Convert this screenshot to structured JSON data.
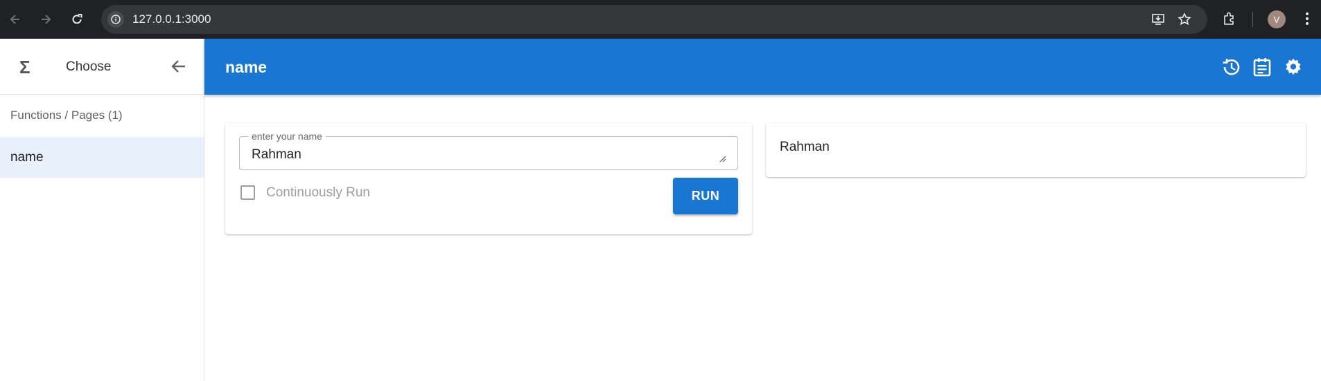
{
  "browser": {
    "url": "127.0.0.1:3000",
    "avatar_initial": "V"
  },
  "sidebar": {
    "header_title": "Choose",
    "section_title": "Functions / Pages (1)",
    "items": [
      {
        "label": "name",
        "selected": true
      }
    ]
  },
  "appbar": {
    "title": "name",
    "color": "#1976d2",
    "icons": [
      "history-icon",
      "calendar-icon",
      "settings-icon"
    ]
  },
  "form": {
    "field_label": "enter your name",
    "field_value": "Rahman",
    "checkbox_label": "Continuously Run",
    "checkbox_checked": false,
    "run_label": "RUN"
  },
  "output": {
    "text": "Rahman"
  }
}
